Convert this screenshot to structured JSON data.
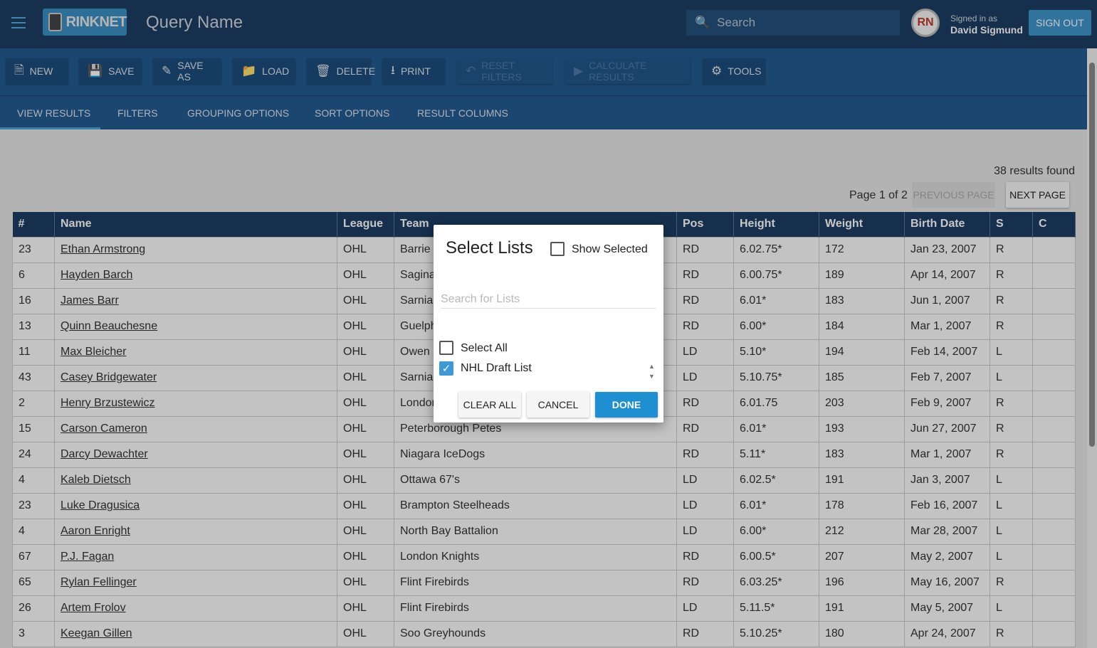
{
  "header": {
    "logo": "RINKNET",
    "title": "Query Name",
    "search_placeholder": "Search",
    "avatar": "RN",
    "signed_in_label": "Signed in as",
    "user": "David Sigmund",
    "sign_out": "SIGN OUT"
  },
  "toolbar": [
    {
      "label": "NEW",
      "icon": "file-icon",
      "glyph": "🗎",
      "disabled": false
    },
    {
      "label": "SAVE",
      "icon": "floppy-icon",
      "glyph": "💾",
      "disabled": false
    },
    {
      "label": "SAVE AS",
      "icon": "pencil-icon",
      "glyph": "✎",
      "disabled": false
    },
    {
      "label": "LOAD",
      "icon": "folder-icon",
      "glyph": "📁",
      "disabled": false
    },
    {
      "label": "DELETE",
      "icon": "trash-icon",
      "glyph": "🗑",
      "disabled": false
    },
    {
      "label": "PRINT",
      "icon": "download-icon",
      "glyph": "⭳",
      "disabled": false
    },
    {
      "label": "RESET FILTERS",
      "icon": "undo-icon",
      "glyph": "↶",
      "disabled": true
    },
    {
      "label": "CALCULATE RESULTS",
      "icon": "play-icon",
      "glyph": "▶",
      "disabled": true
    },
    {
      "label": "TOOLS",
      "icon": "gear-icon",
      "glyph": "⚙",
      "disabled": false
    }
  ],
  "tabs": [
    "VIEW RESULTS",
    "FILTERS",
    "GROUPING OPTIONS",
    "SORT OPTIONS",
    "RESULT COLUMNS"
  ],
  "results": {
    "count_text": "38 results found",
    "page_text": "Page 1 of 2",
    "prev": "PREVIOUS PAGE",
    "next": "NEXT PAGE"
  },
  "table": {
    "columns": [
      "#",
      "Name",
      "League",
      "Team",
      "Pos",
      "Height",
      "Weight",
      "Birth Date",
      "S",
      "C"
    ],
    "rows": [
      [
        "23",
        "Ethan Armstrong",
        "OHL",
        "Barrie Colts",
        "RD",
        "6.02.75*",
        "172",
        "Jan 23, 2007",
        "R",
        ""
      ],
      [
        "6",
        "Hayden Barch",
        "OHL",
        "Saginaw Spirit",
        "RD",
        "6.00.75*",
        "189",
        "Apr 14, 2007",
        "R",
        ""
      ],
      [
        "16",
        "James Barr",
        "OHL",
        "Sarnia Sting",
        "RD",
        "6.01*",
        "183",
        "Jun 1, 2007",
        "R",
        ""
      ],
      [
        "13",
        "Quinn Beauchesne",
        "OHL",
        "Guelph Storm",
        "RD",
        "6.00*",
        "184",
        "Mar 1, 2007",
        "R",
        ""
      ],
      [
        "11",
        "Max Bleicher",
        "OHL",
        "Owen Sound Attack",
        "LD",
        "5.10*",
        "194",
        "Feb 14, 2007",
        "L",
        ""
      ],
      [
        "43",
        "Casey Bridgewater",
        "OHL",
        "Sarnia Sting",
        "LD",
        "5.10.75*",
        "185",
        "Feb 7, 2007",
        "L",
        ""
      ],
      [
        "2",
        "Henry Brzustewicz",
        "OHL",
        "London Knights",
        "RD",
        "6.01.75",
        "203",
        "Feb 9, 2007",
        "R",
        ""
      ],
      [
        "15",
        "Carson Cameron",
        "OHL",
        "Peterborough Petes",
        "RD",
        "6.01*",
        "193",
        "Jun 27, 2007",
        "R",
        ""
      ],
      [
        "24",
        "Darcy Dewachter",
        "OHL",
        "Niagara IceDogs",
        "RD",
        "5.11*",
        "183",
        "Mar 1, 2007",
        "R",
        ""
      ],
      [
        "4",
        "Kaleb Dietsch",
        "OHL",
        "Ottawa 67's",
        "LD",
        "6.02.5*",
        "191",
        "Jan 3, 2007",
        "L",
        ""
      ],
      [
        "23",
        "Luke Dragusica",
        "OHL",
        "Brampton Steelheads",
        "LD",
        "6.01*",
        "178",
        "Feb 16, 2007",
        "L",
        ""
      ],
      [
        "4",
        "Aaron Enright",
        "OHL",
        "North Bay Battalion",
        "LD",
        "6.00*",
        "212",
        "Mar 28, 2007",
        "L",
        ""
      ],
      [
        "67",
        "P.J. Fagan",
        "OHL",
        "London Knights",
        "RD",
        "6.00.5*",
        "207",
        "May 2, 2007",
        "L",
        ""
      ],
      [
        "65",
        "Rylan Fellinger",
        "OHL",
        "Flint Firebirds",
        "RD",
        "6.03.25*",
        "196",
        "May 16, 2007",
        "R",
        ""
      ],
      [
        "26",
        "Artem Frolov",
        "OHL",
        "Flint Firebirds",
        "LD",
        "5.11.5*",
        "191",
        "May 5, 2007",
        "L",
        ""
      ],
      [
        "3",
        "Keegan Gillen",
        "OHL",
        "Soo Greyhounds",
        "RD",
        "5.10.25*",
        "180",
        "Apr 24, 2007",
        "R",
        ""
      ]
    ]
  },
  "modal": {
    "title": "Select Lists",
    "show_selected": "Show Selected",
    "search_placeholder": "Search for Lists",
    "select_all": "Select All",
    "items": [
      {
        "label": "NHL Draft List",
        "checked": true
      }
    ],
    "clear_all": "CLEAR ALL",
    "cancel": "CANCEL",
    "done": "DONE"
  }
}
